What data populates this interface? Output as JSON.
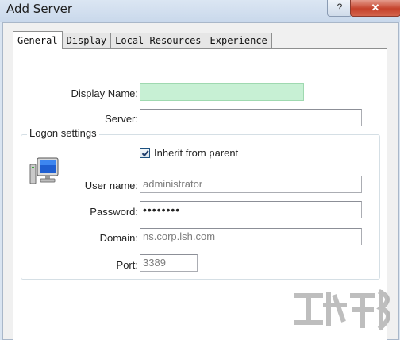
{
  "window": {
    "title": "Add Server",
    "help_label": "?",
    "close_label": "✕"
  },
  "tabs": [
    {
      "label": "General",
      "active": true
    },
    {
      "label": "Display"
    },
    {
      "label": "Local Resources"
    },
    {
      "label": "Experience"
    }
  ],
  "form": {
    "display_name_label": "Display Name:",
    "display_name_value": "",
    "server_label": "Server:",
    "server_value": "",
    "logon_settings_label": "Logon settings",
    "inherit_label": "Inherit from parent",
    "inherit_checked": true,
    "username_label": "User name:",
    "username_value": "administrator",
    "password_label": "Password:",
    "password_value": "••••••••",
    "domain_label": "Domain:",
    "domain_value": "ns.corp.lsh.com",
    "port_label": "Port:",
    "port_value": "3389"
  },
  "icons": {
    "server": "computer-icon",
    "watermark": "watermark-logo"
  },
  "colors": {
    "display_name_bg": "#c7f0d4",
    "close_button": "#c5412b",
    "title_bar": "#d9e4f1"
  }
}
